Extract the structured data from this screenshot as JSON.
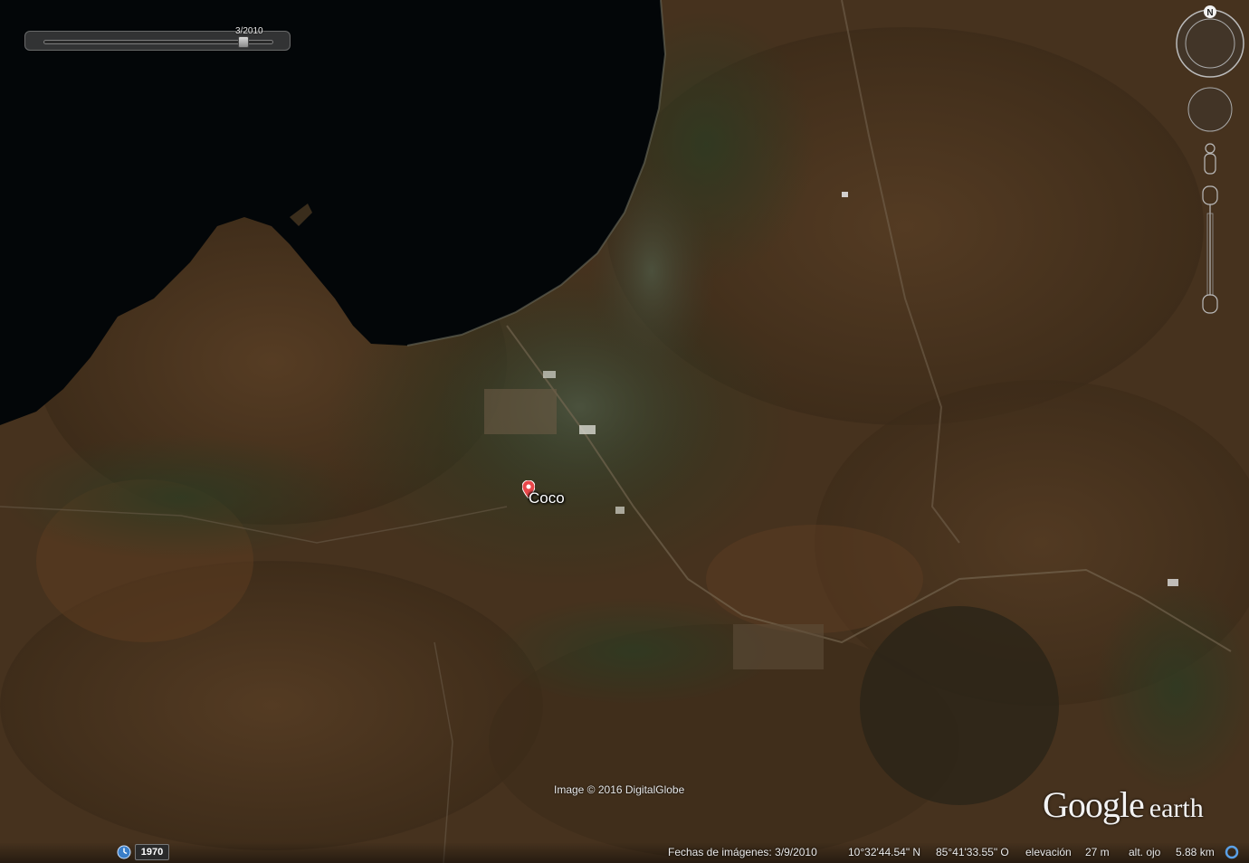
{
  "app": "Google Earth",
  "time_slider": {
    "date": "3/2010",
    "position_fraction": 0.87
  },
  "compass": {
    "north_label": "N"
  },
  "placemark": {
    "label": "Coco"
  },
  "copyright": "Image © 2016 DigitalGlobe",
  "logo": {
    "google": "Google",
    "earth": "earth"
  },
  "status_bar": {
    "year": "1970",
    "imagery_date": "Fechas de imágenes: 3/9/2010",
    "latitude": "10°32'44.54\" N",
    "longitude": "85°41'33.55\" O",
    "elevation_label": "elevación",
    "elevation_value": "27 m",
    "eye_alt_label": "alt. ojo",
    "eye_alt_value": "5.88 km"
  },
  "colors": {
    "water": "#030608",
    "land": "#4a3520",
    "vegetation": "#2f3a1f",
    "placemark_pin": "#e8474a"
  },
  "icons": [
    "compass-ring-icon",
    "look-joystick-icon",
    "pegman-icon",
    "zoom-slider-icon",
    "historical-imagery-icon",
    "streaming-indicator-icon",
    "placemark-pin-icon"
  ]
}
